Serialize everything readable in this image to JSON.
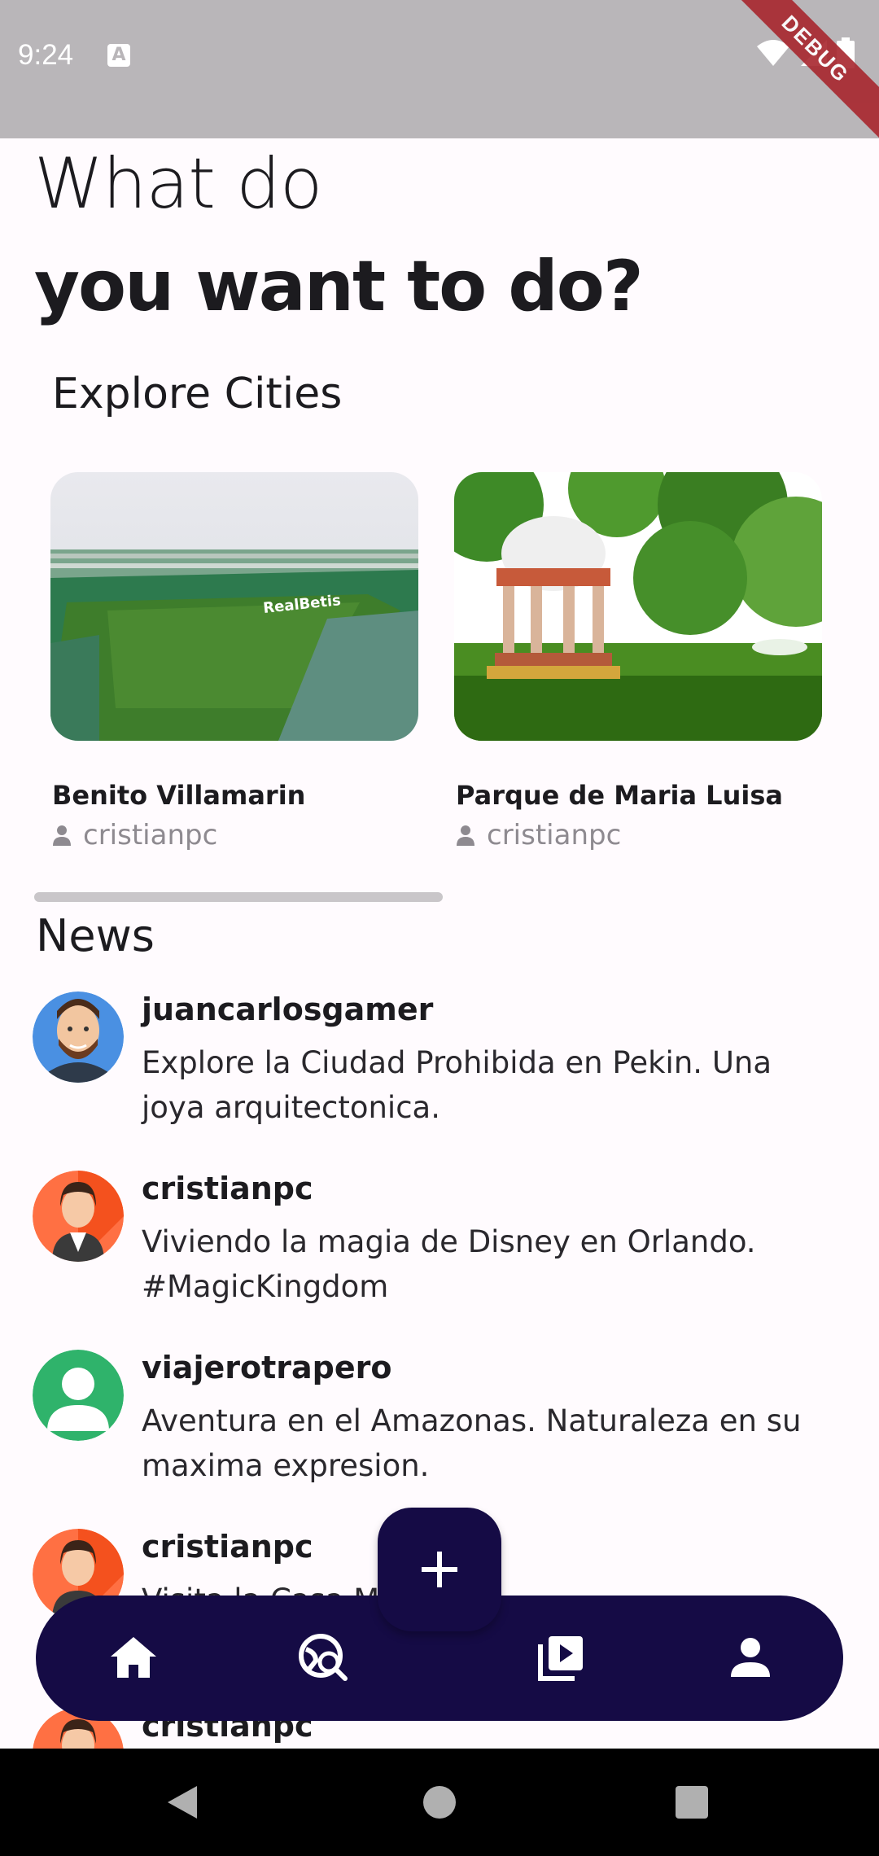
{
  "status_bar": {
    "time": "9:24",
    "debug_label": "DEBUG"
  },
  "header": {
    "line1": "What do",
    "line2": "you want to do?"
  },
  "explore": {
    "title": "Explore Cities",
    "cities": [
      {
        "name": "Benito Villamarin",
        "author": "cristianpc"
      },
      {
        "name": "Parque de Maria Luisa",
        "author": "cristianpc"
      }
    ],
    "stadium_sign": "RealBetis"
  },
  "news": {
    "title": "News",
    "items": [
      {
        "user": "juancarlosgamer",
        "text": "Explore la Ciudad Prohibida en Pekin. Una joya arquitectonica."
      },
      {
        "user": "cristianpc",
        "text": "Viviendo la magia de Disney en Orlando. #MagicKingdom"
      },
      {
        "user": "viajerotrapero",
        "text": "Aventura en el Amazonas. Naturaleza en su maxima expresion."
      },
      {
        "user": "cristianpc",
        "text": "Visita la Casa M... ica ... ..."
      },
      {
        "user": "cristianpc",
        "text": ""
      }
    ]
  },
  "bottom_nav": {
    "items": [
      {
        "icon": "home-icon"
      },
      {
        "icon": "travel-explore-icon"
      },
      {
        "icon": "video-library-icon"
      },
      {
        "icon": "person-icon"
      }
    ],
    "fab_icon": "add-icon"
  },
  "colors": {
    "nav_bg": "#150b45",
    "page_bg": "#fffbfe",
    "status_bar": "#b9b6b9",
    "debug": "#a8262e"
  }
}
